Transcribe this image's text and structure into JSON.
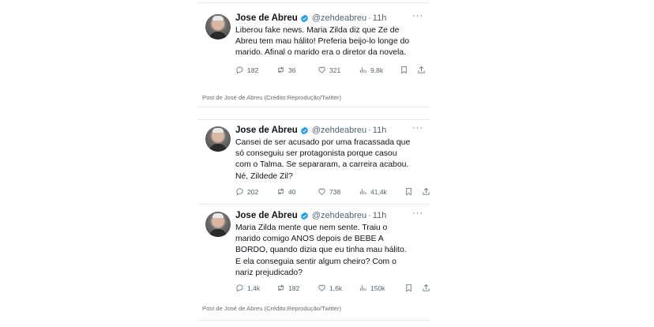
{
  "tweets": [
    {
      "name": "Jose de Abreu",
      "handle": "@zehdeabreu",
      "dot": "·",
      "time": "11h",
      "more": "···",
      "text": "Liberou fake news. Maria Zilda diz que Ze de\nAbreu tem mau hálito! Preferia beijo-lo longe do\nmarido. Afinal o marido era o diretor da novela.",
      "replies": "182",
      "retweets": "36",
      "likes": "321",
      "views": "9,8k"
    },
    {
      "name": "Jose de Abreu",
      "handle": "@zehdeabreu",
      "dot": "·",
      "time": "11h",
      "more": "···",
      "text": "Cansei de ser acusado por uma fracassada que\nsó conseguiu ser protagonista porque casou\ncom o Talma. Se separaram, a carreira acabou.\nNé, Zildede Zil?",
      "replies": "202",
      "retweets": "40",
      "likes": "738",
      "views": "41,4k"
    },
    {
      "name": "Jose de Abreu",
      "handle": "@zehdeabreu",
      "dot": "·",
      "time": "11h",
      "more": "···",
      "text": "Maria Zilda mente que nem sente. Traiu o\nmarido comigo ANOS depois de BEBE A\nBORDO, quando dizia que eu tinha mau hálito.\nE ela conseguia sentir algum cheiro? Com o\nnariz prejudicado?",
      "replies": "1,4k",
      "retweets": "182",
      "likes": "1,6k",
      "views": "150k"
    }
  ],
  "captions": [
    "Post de José de Abreu (Crédito:Reprodução/Twitter)",
    "Post de José de Abreu (Crédito:Reprodução/Twitter)"
  ],
  "colors": {
    "verified": "#1d9bf0",
    "muted": "#536471"
  }
}
